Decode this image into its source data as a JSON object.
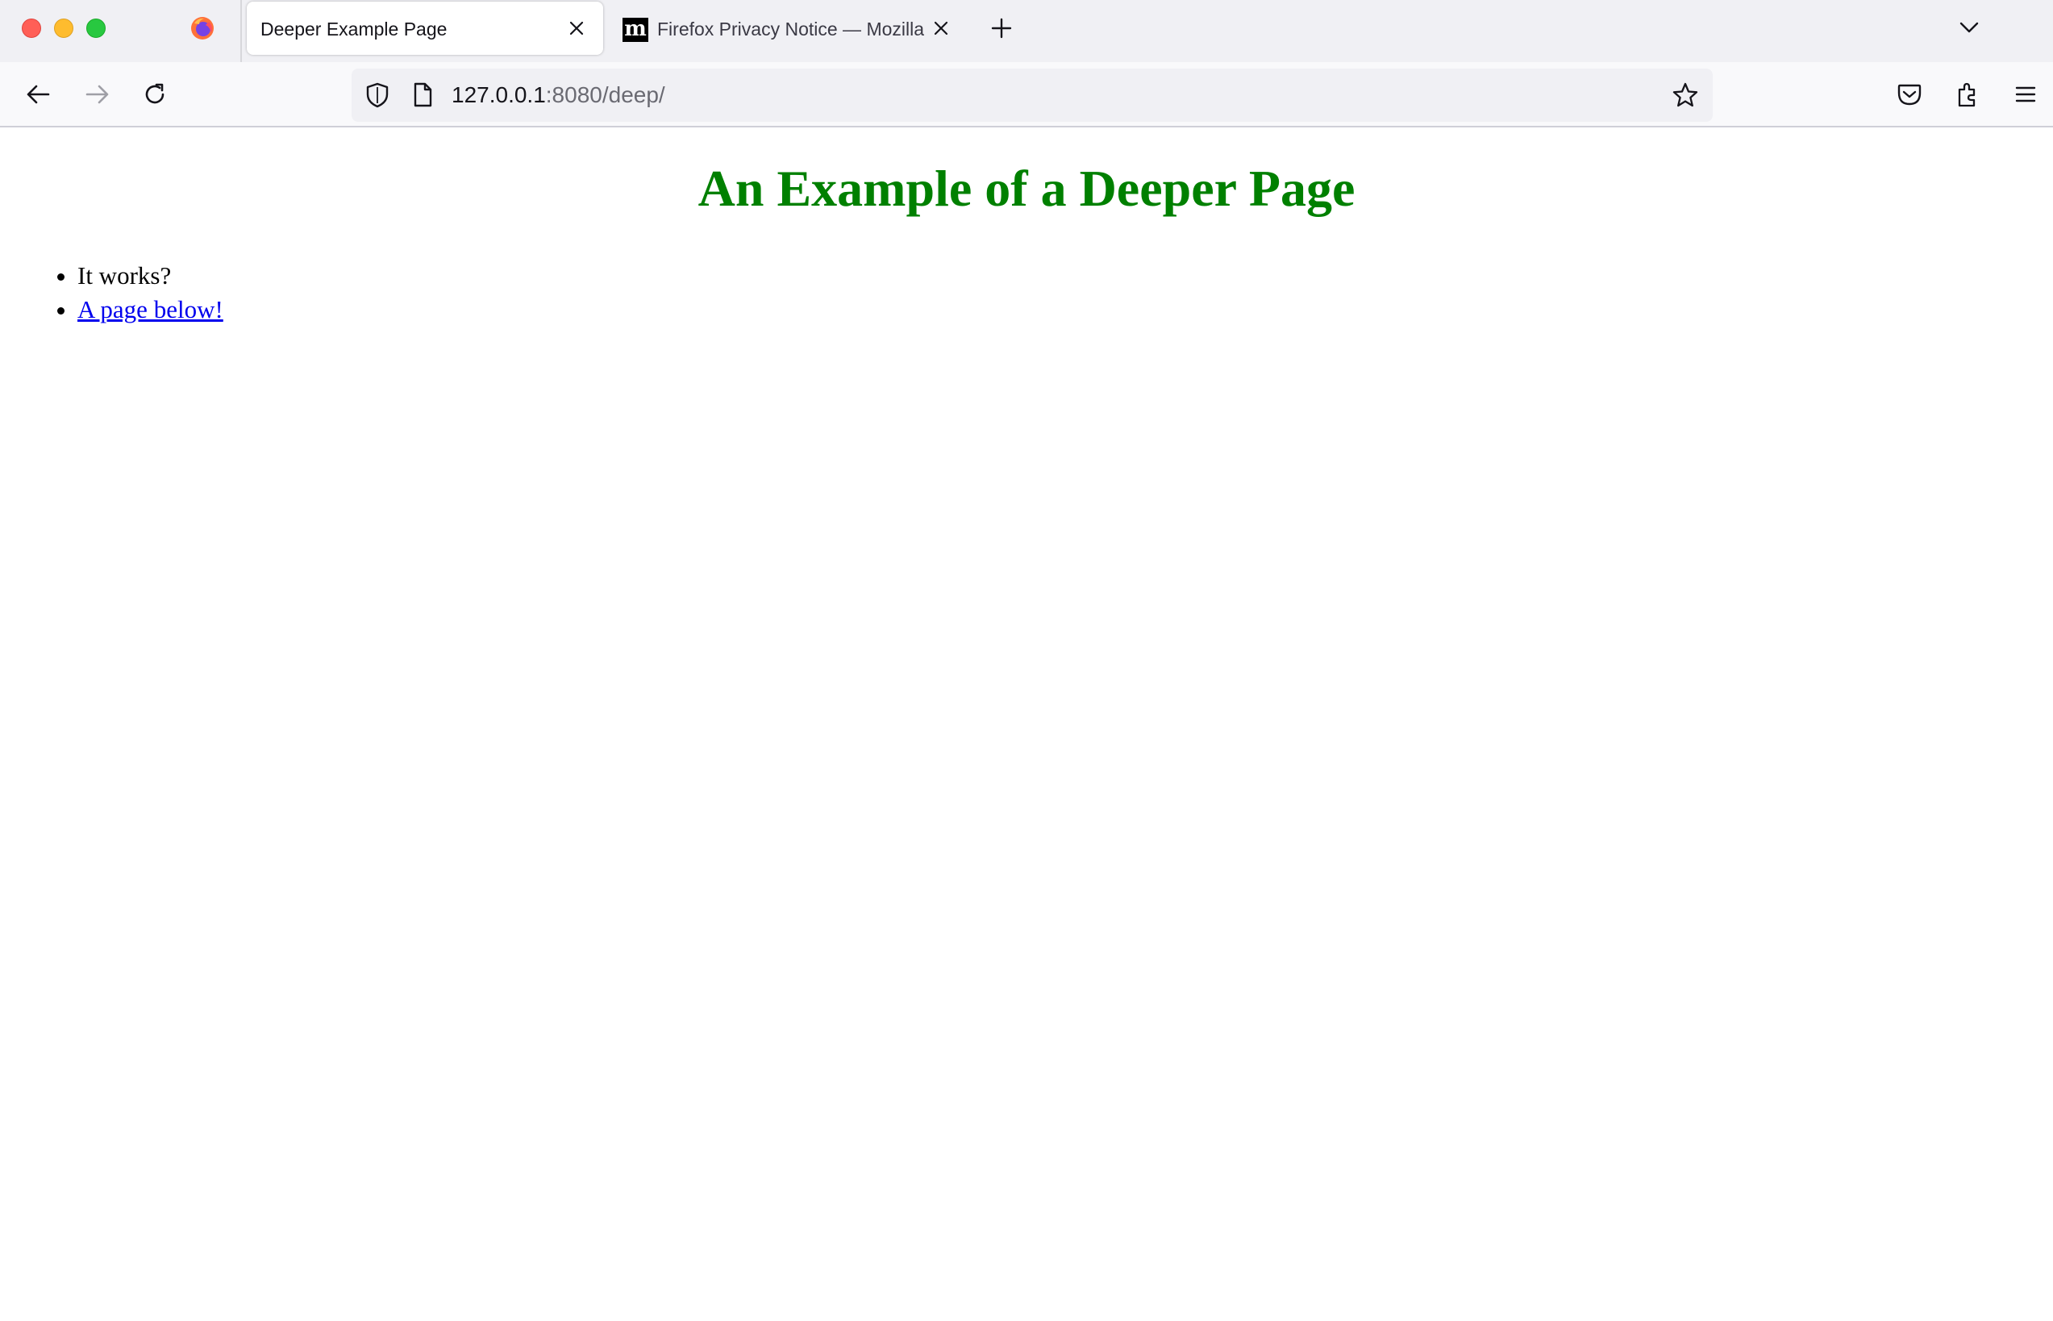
{
  "browser": {
    "tabs": [
      {
        "title": "Deeper Example Page",
        "active": true
      },
      {
        "title": "Firefox Privacy Notice — Mozilla",
        "active": false,
        "favicon": "m"
      }
    ],
    "url": {
      "host": "127.0.0.1",
      "rest": ":8080/deep/"
    },
    "icons": {
      "firefox": "firefox-logo-icon",
      "new_tab": "plus-icon",
      "tab_list": "chevron-down-icon",
      "back": "arrow-left-icon",
      "forward": "arrow-right-icon",
      "reload": "reload-icon",
      "tracking": "shield-icon",
      "page_info": "page-icon",
      "bookmark": "star-icon",
      "pocket": "pocket-icon",
      "extensions": "puzzle-icon",
      "menu": "hamburger-menu-icon"
    }
  },
  "page": {
    "heading": "An Example of a Deeper Page",
    "items": [
      {
        "text": "It works?",
        "link": false
      },
      {
        "text": "A page below!",
        "link": true
      }
    ],
    "colors": {
      "heading": "#008000",
      "link": "#0000ee"
    }
  }
}
